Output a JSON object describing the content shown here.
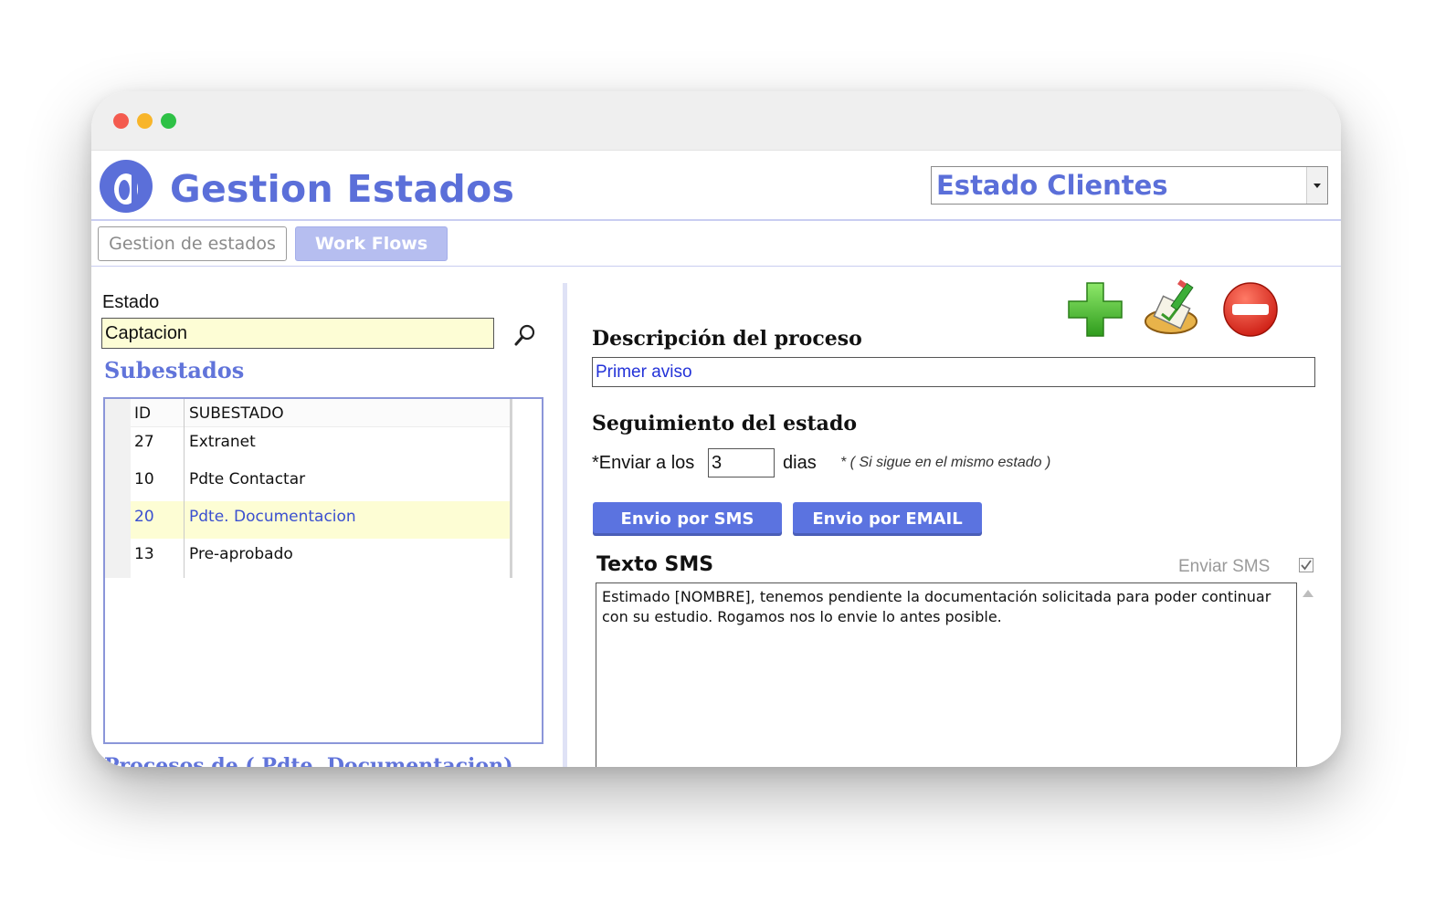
{
  "app": {
    "title": "Gestion Estados"
  },
  "header": {
    "dropdown_value": "Estado Clientes"
  },
  "tabs": [
    {
      "label": "Gestion de estados"
    },
    {
      "label": "Work Flows"
    }
  ],
  "left": {
    "estado_label": "Estado",
    "estado_value": "Captacion",
    "subestados_title": "Subestados",
    "columns": [
      "ID",
      "SUBESTADO"
    ],
    "rows": [
      {
        "id": "27",
        "name": "Extranet"
      },
      {
        "id": "10",
        "name": "Pdte Contactar"
      },
      {
        "id": "20",
        "name": "Pdte. Documentacion"
      },
      {
        "id": "13",
        "name": "Pre-aprobado"
      }
    ],
    "selected_row": 2,
    "procesos_title": "Procesos de ( Pdte. Documentacion)"
  },
  "right": {
    "descripcion_label": "Descripción del proceso",
    "descripcion_value": "Primer aviso",
    "seguimiento_label": "Seguimiento del estado",
    "enviar_label": "*Enviar a los",
    "dias_value": "3",
    "dias_label": "dias",
    "note": "* ( Si sigue en el mismo estado )",
    "btn_sms": "Envio por SMS",
    "btn_email": "Envio por EMAIL",
    "texto_sms_label": "Texto SMS",
    "enviar_sms_label": "Enviar SMS",
    "enviar_sms_checked": true,
    "sms_text": "Estimado [NOMBRE], tenemos pendiente la documentación solicitada para poder continuar con su estudio. Rogamos nos lo envie lo antes posible."
  },
  "icons": {
    "logo": "app-logo",
    "search": "search-icon",
    "add": "add-icon",
    "edit": "edit-icon",
    "delete": "delete-icon"
  },
  "colors": {
    "accent": "#5b6fd9",
    "button": "#5b73e0",
    "selected_row": "#fdfdd4",
    "input_highlight": "#fdfdd5"
  }
}
